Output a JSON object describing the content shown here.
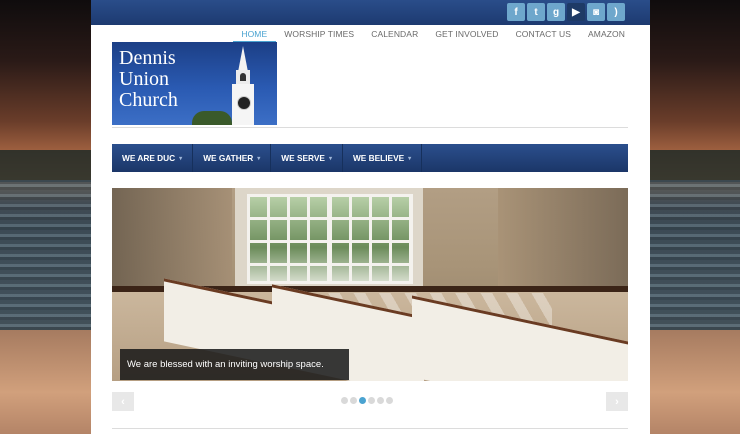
{
  "social": {
    "icons": [
      "facebook-icon",
      "twitter-icon",
      "google-plus-icon",
      "youtube-icon",
      "instagram-icon",
      "rss-icon"
    ],
    "glyphs": [
      "f",
      "t",
      "g",
      "▶",
      "◙",
      ")"
    ]
  },
  "topnav": {
    "items": [
      "HOME",
      "WORSHIP TIMES",
      "CALENDAR",
      "GET INVOLVED",
      "CONTACT US",
      "AMAZON"
    ],
    "active": "HOME"
  },
  "logo": {
    "line1": "Dennis",
    "line2": "Union",
    "line3": "Church"
  },
  "mainnav": {
    "items": [
      "WE ARE DUC",
      "WE GATHER",
      "WE SERVE",
      "WE BELIEVE"
    ],
    "caret": "▾"
  },
  "slider": {
    "caption": "We are blessed with an inviting worship space.",
    "prev": "‹",
    "next": "›",
    "dot_count": 6,
    "active_dot": 3
  },
  "colors": {
    "accent": "#4aa3d1",
    "navy": "#1d3a70"
  }
}
